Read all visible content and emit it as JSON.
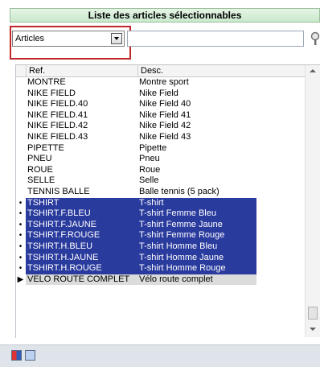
{
  "title": "Liste des articles sélectionnables",
  "filter": {
    "combo_value": "Articles",
    "search_value": ""
  },
  "grid": {
    "headers": {
      "ref": "Ref.",
      "desc": "Desc."
    },
    "rows": [
      {
        "ref": "MONTRE",
        "desc": "Montre sport",
        "state": ""
      },
      {
        "ref": "NIKE FIELD",
        "desc": "Nike Field",
        "state": ""
      },
      {
        "ref": "NIKE FIELD.40",
        "desc": "Nike Field 40",
        "state": ""
      },
      {
        "ref": "NIKE FIELD.41",
        "desc": "Nike Field 41",
        "state": ""
      },
      {
        "ref": "NIKE FIELD.42",
        "desc": "Nike Field 42",
        "state": ""
      },
      {
        "ref": "NIKE FIELD.43",
        "desc": "Nike Field 43",
        "state": ""
      },
      {
        "ref": "PIPETTE",
        "desc": "Pipette",
        "state": ""
      },
      {
        "ref": "PNEU",
        "desc": "Pneu",
        "state": ""
      },
      {
        "ref": "ROUE",
        "desc": "Roue",
        "state": ""
      },
      {
        "ref": "SELLE",
        "desc": "Selle",
        "state": ""
      },
      {
        "ref": "TENNIS BALLE",
        "desc": "Balle tennis (5 pack)",
        "state": ""
      },
      {
        "ref": "TSHIRT",
        "desc": "T-shirt",
        "state": "selected"
      },
      {
        "ref": "TSHIRT.F.BLEU",
        "desc": "T-shirt Femme Bleu",
        "state": "selected"
      },
      {
        "ref": "TSHIRT.F.JAUNE",
        "desc": "T-shirt Femme Jaune",
        "state": "selected"
      },
      {
        "ref": "TSHIRT.F.ROUGE",
        "desc": "T-shirt Femme Rouge",
        "state": "selected"
      },
      {
        "ref": "TSHIRT.H.BLEU",
        "desc": "T-shirt Homme Bleu",
        "state": "selected"
      },
      {
        "ref": "TSHIRT.H.JAUNE",
        "desc": "T-shirt Homme Jaune",
        "state": "selected"
      },
      {
        "ref": "TSHIRT.H.ROUGE",
        "desc": "T-shirt Homme Rouge",
        "state": "selected"
      },
      {
        "ref": "VELO ROUTE COMPLET",
        "desc": "Vélo route complet",
        "state": "current"
      }
    ]
  },
  "colors": {
    "selection": "#2a3b9e",
    "title_bg": "#c9e9cc",
    "highlight": "#c0282c"
  }
}
